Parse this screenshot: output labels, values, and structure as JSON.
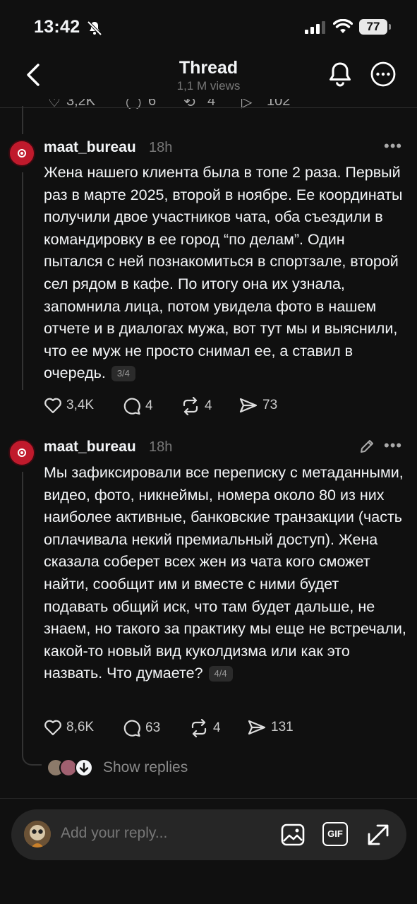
{
  "status_bar": {
    "time": "13:42",
    "battery": "77"
  },
  "header": {
    "title": "Thread",
    "subtitle": "1,1 M views"
  },
  "partial_row": {
    "likes": "3,2K",
    "replies": "6",
    "reposts": "4",
    "shares": "102"
  },
  "posts": [
    {
      "username": "maat_bureau",
      "time": "18h",
      "text": "Жена нашего клиента была в топе 2 раза. Первый раз в марте 2025, второй в ноябре. Ее координаты получили двое участников чата, оба съездили в командировку в ее город “по делам”. Один пытался с ней познакомиться в спортзале, второй сел рядом в кафе. По итогу она их узнала, запомнила лица, потом увидела фото в нашем отчете и в диалогах мужа, вот тут мы и выяснили, что ее муж не просто снимал ее, а ставил в очередь.",
      "page": "3/4",
      "likes": "3,4K",
      "replies": "4",
      "reposts": "4",
      "shares": "73"
    },
    {
      "username": "maat_bureau",
      "time": "18h",
      "text": "Мы зафиксировали все переписку с метаданными, видео, фото, никнеймы, номера около 80 из них наиболее активные, банковские транзакции (часть оплачивала некий премиальный доступ). Жена сказала соберет всех жен из чата кого сможет найти, сообщит им и вместе с ними будет подавать общий иск, что там будет дальше, не знаем, но такого за практику мы еще не встречали, какой-то новый вид куколдизма или как это назвать. Что думаете?",
      "page": "4/4",
      "likes": "8,6K",
      "replies": "63",
      "reposts": "4",
      "shares": "131"
    }
  ],
  "show_replies_label": "Show replies",
  "composer": {
    "placeholder": "Add your reply...",
    "gif_label": "GIF"
  },
  "colors": {
    "background": "#101010",
    "text": "#f3f5f7",
    "muted": "#777777",
    "avatar_red": "#c01a2c",
    "composer_bg": "#262626"
  }
}
